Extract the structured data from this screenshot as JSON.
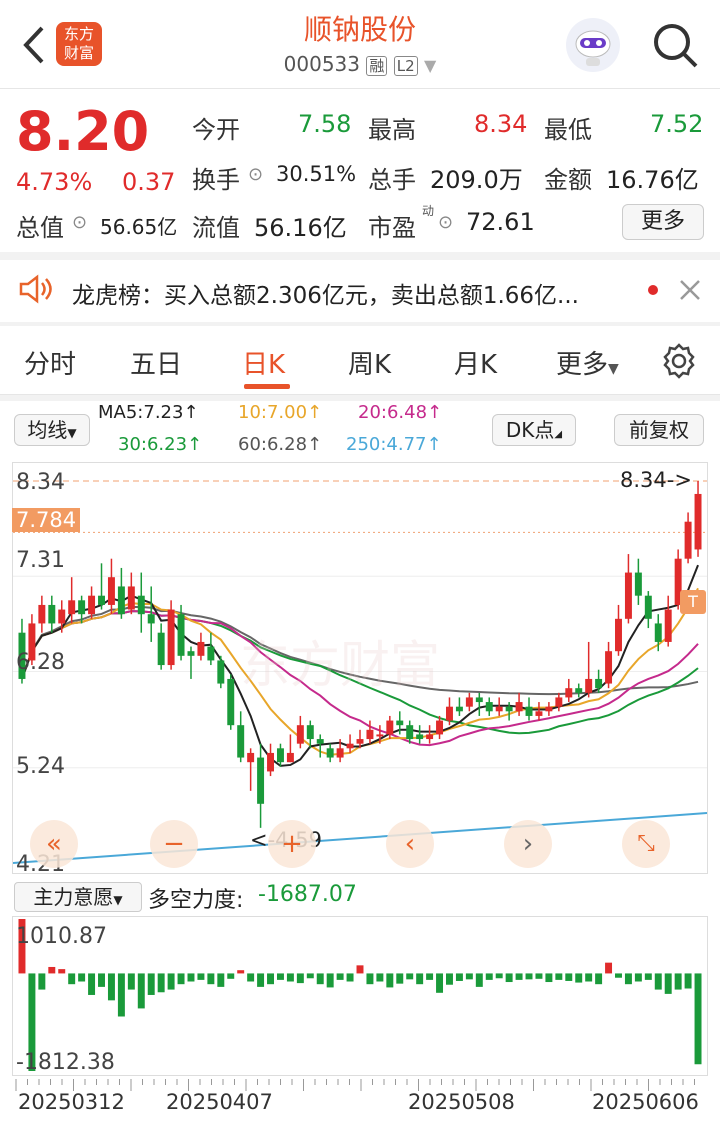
{
  "header": {
    "title": "顺钠股份",
    "code": "000533",
    "tag_margin": "融",
    "tag_level": "L2",
    "logo_line1": "东方",
    "logo_line2": "财富"
  },
  "quote": {
    "price": "8.20",
    "change_pct": "4.73%",
    "change_amt": "0.37",
    "open_label": "今开",
    "open": "7.58",
    "high_label": "最高",
    "high": "8.34",
    "low_label": "最低",
    "low": "7.52",
    "turnover_label": "换手",
    "turnover": "30.51%",
    "volume_label": "总手",
    "volume": "209.0万",
    "amount_label": "金额",
    "amount": "16.76亿",
    "mktcap_label": "总值",
    "mktcap": "56.65亿",
    "float_label": "流值",
    "float": "56.16亿",
    "pe_label": "市盈",
    "pe_sup": "动",
    "pe": "72.61",
    "more_button": "更多"
  },
  "notice": {
    "text": "龙虎榜：买入总额2.306亿元，卖出总额1.66亿..."
  },
  "tabs": [
    "分时",
    "五日",
    "日K",
    "周K",
    "月K",
    "更多"
  ],
  "active_tab": "日K",
  "controls": {
    "ma_select": "均线",
    "dk_button": "DK点",
    "fq_button": "前复权",
    "ma5": "MA5:7.23↑",
    "ma10": "10:7.00↑",
    "ma20": "20:6.48↑",
    "ma30": "30:6.23↑",
    "ma60": "60:6.28↑",
    "ma250": "250:4.77↑"
  },
  "chart_axis": {
    "y_top": "8.34",
    "y_current": "7.784",
    "y_2": "7.31",
    "y_3": "6.28",
    "y_4": "5.24",
    "y_bottom": "4.21",
    "high_marker": "8.34->",
    "low_marker": "<-4.59"
  },
  "indicator": {
    "select": "主力意愿",
    "name": "多空力度:",
    "value": "-1687.07",
    "top": "1010.87",
    "bottom": "-1812.38"
  },
  "dates": [
    "20250312",
    "20250407",
    "20250508",
    "20250606"
  ],
  "colors": {
    "up": "#e02b2b",
    "down": "#1a9a3a",
    "accent": "#e8532a"
  },
  "chart_data": {
    "type": "candlestick",
    "ylim": [
      4.21,
      8.34
    ],
    "candles": [
      [
        6.7,
        6.2,
        6.85,
        6.15
      ],
      [
        6.4,
        6.8,
        6.9,
        6.35
      ],
      [
        6.8,
        7.0,
        7.1,
        6.7
      ],
      [
        7.0,
        6.8,
        7.1,
        6.7
      ],
      [
        6.8,
        6.95,
        7.05,
        6.7
      ],
      [
        6.9,
        7.05,
        7.3,
        6.8
      ],
      [
        7.05,
        6.9,
        7.1,
        6.8
      ],
      [
        6.9,
        7.1,
        7.2,
        6.85
      ],
      [
        7.1,
        7.0,
        7.45,
        6.95
      ],
      [
        7.0,
        7.3,
        7.5,
        6.9
      ],
      [
        7.2,
        6.9,
        7.4,
        6.85
      ],
      [
        6.95,
        7.2,
        7.35,
        6.9
      ],
      [
        7.1,
        6.9,
        7.35,
        6.7
      ],
      [
        6.9,
        6.8,
        7.2,
        6.6
      ],
      [
        6.7,
        6.35,
        6.8,
        6.3
      ],
      [
        6.35,
        6.95,
        7.05,
        6.3
      ],
      [
        6.9,
        6.45,
        7.0,
        6.4
      ],
      [
        6.5,
        6.45,
        6.55,
        6.2
      ],
      [
        6.45,
        6.6,
        6.7,
        6.4
      ],
      [
        6.55,
        6.4,
        6.7,
        6.35
      ],
      [
        6.4,
        6.15,
        6.45,
        6.1
      ],
      [
        6.2,
        5.7,
        6.25,
        5.65
      ],
      [
        5.7,
        5.35,
        5.85,
        5.3
      ],
      [
        5.3,
        5.4,
        5.45,
        4.99
      ],
      [
        5.35,
        4.85,
        5.5,
        4.59
      ],
      [
        5.2,
        5.4,
        5.5,
        5.15
      ],
      [
        5.45,
        5.3,
        5.5,
        5.25
      ],
      [
        5.3,
        5.4,
        5.6,
        5.3
      ],
      [
        5.5,
        5.7,
        5.8,
        5.45
      ],
      [
        5.7,
        5.55,
        5.75,
        5.45
      ],
      [
        5.55,
        5.5,
        5.6,
        5.35
      ],
      [
        5.45,
        5.35,
        5.5,
        5.3
      ],
      [
        5.35,
        5.45,
        5.55,
        5.3
      ],
      [
        5.45,
        5.5,
        5.6,
        5.4
      ],
      [
        5.5,
        5.55,
        5.65,
        5.45
      ],
      [
        5.55,
        5.65,
        5.75,
        5.5
      ],
      [
        5.6,
        5.6,
        5.7,
        5.5
      ],
      [
        5.6,
        5.75,
        5.8,
        5.55
      ],
      [
        5.75,
        5.7,
        5.85,
        5.6
      ],
      [
        5.7,
        5.55,
        5.75,
        5.5
      ],
      [
        5.6,
        5.55,
        5.7,
        5.5
      ],
      [
        5.55,
        5.6,
        5.7,
        5.5
      ],
      [
        5.6,
        5.75,
        5.8,
        5.55
      ],
      [
        5.75,
        5.9,
        6.0,
        5.7
      ],
      [
        5.9,
        5.85,
        6.0,
        5.8
      ],
      [
        5.9,
        6.0,
        6.05,
        5.85
      ],
      [
        6.0,
        5.95,
        6.05,
        5.8
      ],
      [
        5.95,
        5.85,
        6.0,
        5.8
      ],
      [
        5.85,
        5.9,
        6.0,
        5.8
      ],
      [
        5.9,
        5.85,
        5.95,
        5.75
      ],
      [
        5.85,
        5.95,
        6.05,
        5.8
      ],
      [
        5.9,
        5.8,
        6.0,
        5.75
      ],
      [
        5.8,
        5.85,
        5.95,
        5.75
      ],
      [
        5.85,
        5.9,
        5.95,
        5.8
      ],
      [
        5.9,
        6.0,
        6.05,
        5.85
      ],
      [
        6.0,
        6.1,
        6.2,
        5.95
      ],
      [
        6.1,
        6.05,
        6.15,
        6.0
      ],
      [
        6.05,
        6.2,
        6.6,
        6.0
      ],
      [
        6.2,
        6.1,
        6.3,
        6.05
      ],
      [
        6.15,
        6.5,
        6.6,
        6.1
      ],
      [
        6.5,
        6.85,
        7.0,
        6.45
      ],
      [
        6.85,
        7.35,
        7.55,
        6.8
      ],
      [
        7.35,
        7.1,
        7.5,
        7.0
      ],
      [
        7.1,
        6.85,
        7.15,
        6.75
      ],
      [
        6.8,
        6.6,
        6.9,
        6.5
      ],
      [
        6.6,
        6.95,
        7.1,
        6.55
      ],
      [
        7.0,
        7.5,
        7.6,
        6.95
      ],
      [
        7.5,
        7.9,
        8.0,
        7.45
      ],
      [
        7.6,
        8.2,
        8.34,
        7.52
      ]
    ],
    "indicator_values": [
      1010.87,
      -1812.38,
      -300,
      120,
      80,
      -200,
      -150,
      -400,
      -250,
      -500,
      -800,
      -300,
      -650,
      -400,
      -350,
      -300,
      -200,
      -150,
      -120,
      -200,
      -250,
      -100,
      60,
      -150,
      -250,
      -200,
      -120,
      -150,
      -180,
      -90,
      -200,
      -260,
      -120,
      -150,
      150,
      -200,
      -150,
      -260,
      -190,
      -110,
      -200,
      -120,
      -360,
      -210,
      -140,
      -110,
      -250,
      -120,
      -90,
      -160,
      -120,
      -110,
      -100,
      -160,
      -120,
      -140,
      -170,
      -150,
      -200,
      200,
      -80,
      -200,
      -150,
      -120,
      -300,
      -380,
      -300,
      -280,
      -1687.07
    ]
  }
}
